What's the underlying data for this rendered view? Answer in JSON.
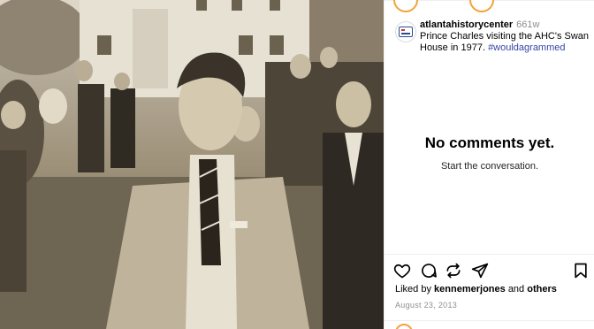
{
  "post": {
    "username": "atlantahistorycenter",
    "age": "661w",
    "caption_text": "Prince Charles visiting the AHC's Swan House in 1977.",
    "hashtag": "#wouldagrammed",
    "photo_alt": "Sepia photograph of a man in a light suit and striped tie with a crowd behind him in front of a large white building"
  },
  "comments": {
    "empty_title": "No comments yet.",
    "empty_subtitle": "Start the conversation."
  },
  "actions": {
    "icons": [
      "heart-icon",
      "comment-icon",
      "share-icon",
      "send-icon",
      "bookmark-icon"
    ]
  },
  "likes": {
    "prefix": "Liked by",
    "user": "kennemerjones",
    "joiner": "and",
    "others": "others"
  },
  "date": "August 23, 2013"
}
